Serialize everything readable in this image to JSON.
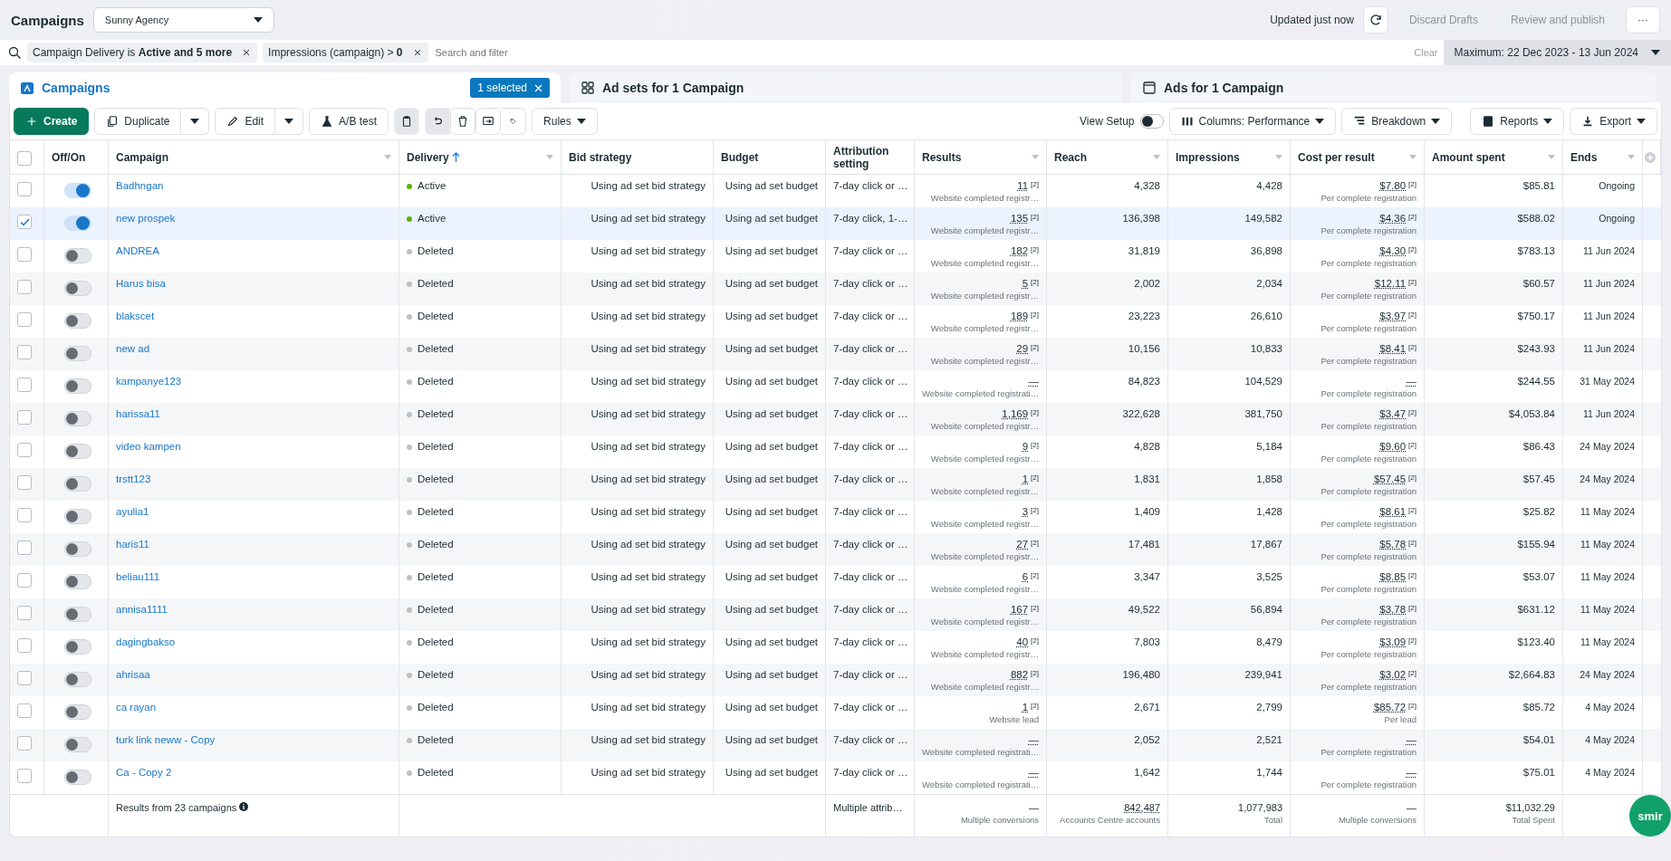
{
  "header": {
    "title": "Campaigns",
    "account": "Sunny Agency",
    "updated": "Updated just now",
    "buttons": [
      {
        "label": "Discard Drafts",
        "disabled": true
      },
      {
        "label": "Review and publish",
        "disabled": true
      }
    ],
    "more": "···"
  },
  "filter": {
    "chips": [
      {
        "label": "Campaign Delivery is **Active and 5 more**"
      },
      {
        "label": "Impressions (campaign) > **0**"
      }
    ],
    "placeholder": "Search and filter",
    "clear": "Clear",
    "date_range": "Maximum: 22 Dec 2023 - 13 Jun 2024"
  },
  "tabs": [
    {
      "label": "Campaigns",
      "selected": true,
      "badge": "1 selected"
    },
    {
      "label": "Ad sets for 1 Campaign",
      "selected": false
    },
    {
      "label": "Ads for 1 Campaign",
      "selected": false
    }
  ],
  "toolbar": {
    "create": "Create",
    "duplicate": "Duplicate",
    "edit": "Edit",
    "ab_test": "A/B test",
    "rules": "Rules",
    "view_setup": {
      "label": "View Setup",
      "on": false
    },
    "columns": "Columns: Performance",
    "breakdown": "Breakdown",
    "reports": "Reports",
    "export": "Export"
  },
  "table": {
    "select_all_checked": false,
    "columns": [
      "Off/On",
      "Campaign",
      "Delivery",
      "Bid strategy",
      "Budget",
      "Attribution setting",
      "Results",
      "Reach",
      "Impressions",
      "Cost per result",
      "Amount spent",
      "Ends"
    ],
    "rows": [
      {
        "name": "Badhngan",
        "delivery": "Active",
        "color": "#5bb600",
        "on": true,
        "selected": false,
        "bid": "Using ad set bid strategy",
        "budget": "Using ad set budget",
        "attribution": "7-day click or …",
        "results": "11",
        "results_note": "[2]",
        "results_type": "Website completed registr…",
        "reach": "4,328",
        "impressions": "4,428",
        "cost": "$7.80",
        "cost_note": "[2]",
        "cost_type": "Per complete registration",
        "spent": "$85.81",
        "ends": "Ongoing"
      },
      {
        "name": "new prospek",
        "delivery": "Active",
        "color": "#5bb600",
        "on": true,
        "selected": true,
        "bid": "Using ad set bid strategy",
        "budget": "Using ad set budget",
        "attribution": "7-day click, 1-…",
        "results": "135",
        "results_note": "[2]",
        "results_type": "Website completed registr…",
        "reach": "136,398",
        "impressions": "149,582",
        "cost": "$4.36",
        "cost_note": "[2]",
        "cost_type": "Per complete registration",
        "spent": "$588.02",
        "ends": "Ongoing"
      },
      {
        "name": "ANDREA",
        "delivery": "Deleted",
        "color": "#bcc0c4",
        "on": false,
        "selected": false,
        "bid": "Using ad set bid strategy",
        "budget": "Using ad set budget",
        "attribution": "7-day click or …",
        "results": "182",
        "results_note": "[2]",
        "results_type": "Website completed registr…",
        "reach": "31,819",
        "impressions": "36,898",
        "cost": "$4.30",
        "cost_note": "[2]",
        "cost_type": "Per complete registration",
        "spent": "$783.13",
        "ends": "11 Jun 2024"
      },
      {
        "name": "Harus bisa",
        "delivery": "Deleted",
        "color": "#bcc0c4",
        "on": false,
        "selected": false,
        "bid": "Using ad set bid strategy",
        "budget": "Using ad set budget",
        "attribution": "7-day click or …",
        "results": "5",
        "results_note": "[2]",
        "results_type": "Website completed registr…",
        "reach": "2,002",
        "impressions": "2,034",
        "cost": "$12.11",
        "cost_note": "[2]",
        "cost_type": "Per complete registration",
        "spent": "$60.57",
        "ends": "11 Jun 2024"
      },
      {
        "name": "blakscet",
        "delivery": "Deleted",
        "color": "#bcc0c4",
        "on": false,
        "selected": false,
        "bid": "Using ad set bid strategy",
        "budget": "Using ad set budget",
        "attribution": "7-day click or …",
        "results": "189",
        "results_note": "[2]",
        "results_type": "Website completed registr…",
        "reach": "23,223",
        "impressions": "26,610",
        "cost": "$3.97",
        "cost_note": "[2]",
        "cost_type": "Per complete registration",
        "spent": "$750.17",
        "ends": "11 Jun 2024"
      },
      {
        "name": "new ad",
        "delivery": "Deleted",
        "color": "#bcc0c4",
        "on": false,
        "selected": false,
        "bid": "Using ad set bid strategy",
        "budget": "Using ad set budget",
        "attribution": "7-day click or …",
        "results": "29",
        "results_note": "[2]",
        "results_type": "Website completed registr…",
        "reach": "10,156",
        "impressions": "10,833",
        "cost": "$8.41",
        "cost_note": "[2]",
        "cost_type": "Per complete registration",
        "spent": "$243.93",
        "ends": "11 Jun 2024"
      },
      {
        "name": "kampanye123",
        "delivery": "Deleted",
        "color": "#bcc0c4",
        "on": false,
        "selected": false,
        "bid": "Using ad set bid strategy",
        "budget": "Using ad set budget",
        "attribution": "7-day click or …",
        "results": "—",
        "results_type": "Website completed registrati…",
        "reach": "84,823",
        "impressions": "104,529",
        "cost": "—",
        "cost_type": "Per complete registration",
        "spent": "$244.55",
        "ends": "31 May 2024"
      },
      {
        "name": "harissa11",
        "delivery": "Deleted",
        "color": "#bcc0c4",
        "on": false,
        "selected": false,
        "bid": "Using ad set bid strategy",
        "budget": "Using ad set budget",
        "attribution": "7-day click or …",
        "results": "1,169",
        "results_note": "[2]",
        "results_type": "Website completed registr…",
        "reach": "322,628",
        "impressions": "381,750",
        "cost": "$3.47",
        "cost_note": "[2]",
        "cost_type": "Per complete registration",
        "spent": "$4,053.84",
        "ends": "11 Jun 2024"
      },
      {
        "name": "video kampen",
        "delivery": "Deleted",
        "color": "#bcc0c4",
        "on": false,
        "selected": false,
        "bid": "Using ad set bid strategy",
        "budget": "Using ad set budget",
        "attribution": "7-day click or …",
        "results": "9",
        "results_note": "[2]",
        "results_type": "Website completed registr…",
        "reach": "4,828",
        "impressions": "5,184",
        "cost": "$9.60",
        "cost_note": "[2]",
        "cost_type": "Per complete registration",
        "spent": "$86.43",
        "ends": "24 May 2024"
      },
      {
        "name": "trstt123",
        "delivery": "Deleted",
        "color": "#bcc0c4",
        "on": false,
        "selected": false,
        "bid": "Using ad set bid strategy",
        "budget": "Using ad set budget",
        "attribution": "7-day click or …",
        "results": "1",
        "results_note": "[2]",
        "results_type": "Website completed registr…",
        "reach": "1,831",
        "impressions": "1,858",
        "cost": "$57.45",
        "cost_note": "[2]",
        "cost_type": "Per complete registration",
        "spent": "$57.45",
        "ends": "24 May 2024"
      },
      {
        "name": "ayulia1",
        "delivery": "Deleted",
        "color": "#bcc0c4",
        "on": false,
        "selected": false,
        "bid": "Using ad set bid strategy",
        "budget": "Using ad set budget",
        "attribution": "7-day click or …",
        "results": "3",
        "results_note": "[2]",
        "results_type": "Website completed registr…",
        "reach": "1,409",
        "impressions": "1,428",
        "cost": "$8.61",
        "cost_note": "[2]",
        "cost_type": "Per complete registration",
        "spent": "$25.82",
        "ends": "11 May 2024"
      },
      {
        "name": "haris11",
        "delivery": "Deleted",
        "color": "#bcc0c4",
        "on": false,
        "selected": false,
        "bid": "Using ad set bid strategy",
        "budget": "Using ad set budget",
        "attribution": "7-day click or …",
        "results": "27",
        "results_note": "[2]",
        "results_type": "Website completed registr…",
        "reach": "17,481",
        "impressions": "17,867",
        "cost": "$5.78",
        "cost_note": "[2]",
        "cost_type": "Per complete registration",
        "spent": "$155.94",
        "ends": "11 May 2024"
      },
      {
        "name": "beliau111",
        "delivery": "Deleted",
        "color": "#bcc0c4",
        "on": false,
        "selected": false,
        "bid": "Using ad set bid strategy",
        "budget": "Using ad set budget",
        "attribution": "7-day click or …",
        "results": "6",
        "results_note": "[2]",
        "results_type": "Website completed registr…",
        "reach": "3,347",
        "impressions": "3,525",
        "cost": "$8.85",
        "cost_note": "[2]",
        "cost_type": "Per complete registration",
        "spent": "$53.07",
        "ends": "11 May 2024"
      },
      {
        "name": "annisa1111",
        "delivery": "Deleted",
        "color": "#bcc0c4",
        "on": false,
        "selected": false,
        "bid": "Using ad set bid strategy",
        "budget": "Using ad set budget",
        "attribution": "7-day click or …",
        "results": "167",
        "results_note": "[2]",
        "results_type": "Website completed registr…",
        "reach": "49,522",
        "impressions": "56,894",
        "cost": "$3.78",
        "cost_note": "[2]",
        "cost_type": "Per complete registration",
        "spent": "$631.12",
        "ends": "11 May 2024"
      },
      {
        "name": "dagingbakso",
        "delivery": "Deleted",
        "color": "#bcc0c4",
        "on": false,
        "selected": false,
        "bid": "Using ad set bid strategy",
        "budget": "Using ad set budget",
        "attribution": "7-day click or …",
        "results": "40",
        "results_note": "[2]",
        "results_type": "Website completed registr…",
        "reach": "7,803",
        "impressions": "8,479",
        "cost": "$3.09",
        "cost_note": "[2]",
        "cost_type": "Per complete registration",
        "spent": "$123.40",
        "ends": "11 May 2024"
      },
      {
        "name": "ahrisaa",
        "delivery": "Deleted",
        "color": "#bcc0c4",
        "on": false,
        "selected": false,
        "bid": "Using ad set bid strategy",
        "budget": "Using ad set budget",
        "attribution": "7-day click or …",
        "results": "882",
        "results_note": "[2]",
        "results_type": "Website completed registr…",
        "reach": "196,480",
        "impressions": "239,941",
        "cost": "$3.02",
        "cost_note": "[2]",
        "cost_type": "Per complete registration",
        "spent": "$2,664.83",
        "ends": "24 May 2024"
      },
      {
        "name": "ca rayan",
        "delivery": "Deleted",
        "color": "#bcc0c4",
        "on": false,
        "selected": false,
        "bid": "Using ad set bid strategy",
        "budget": "Using ad set budget",
        "attribution": "7-day click or …",
        "results": "1",
        "results_note": "[2]",
        "results_type": "Website lead",
        "reach": "2,671",
        "impressions": "2,799",
        "cost": "$85.72",
        "cost_note": "[2]",
        "cost_type": "Per lead",
        "spent": "$85.72",
        "ends": "4 May 2024"
      },
      {
        "name": "turk link neww - Copy",
        "delivery": "Deleted",
        "color": "#bcc0c4",
        "on": false,
        "selected": false,
        "bid": "Using ad set bid strategy",
        "budget": "Using ad set budget",
        "attribution": "7-day click or …",
        "results": "—",
        "results_type": "Website completed registrati…",
        "reach": "2,052",
        "impressions": "2,521",
        "cost": "—",
        "cost_type": "Per complete registration",
        "spent": "$54.01",
        "ends": "4 May 2024"
      },
      {
        "name": "Ca - Copy 2",
        "delivery": "Deleted",
        "color": "#bcc0c4",
        "on": false,
        "selected": false,
        "bid": "Using ad set bid strategy",
        "budget": "Using ad set budget",
        "attribution": "7-day click or …",
        "results": "—",
        "results_type": "Website completed registrati…",
        "reach": "1,642",
        "impressions": "1,744",
        "cost": "—",
        "cost_type": "Per complete registration",
        "spent": "$75.01",
        "ends": "4 May 2024"
      }
    ],
    "footer": {
      "label": "Results from 23 campaigns",
      "attribution": "Multiple attrib…",
      "results": "—",
      "results_type": "Multiple conversions",
      "reach": "842,487",
      "reach_type": "Accounts Centre accounts",
      "impressions": "1,077,983",
      "impressions_type": "Total",
      "cost": "—",
      "cost_type": "Multiple conversions",
      "spent": "$11,032.29",
      "spent_type": "Total Spent"
    }
  },
  "chat_button": "smir"
}
